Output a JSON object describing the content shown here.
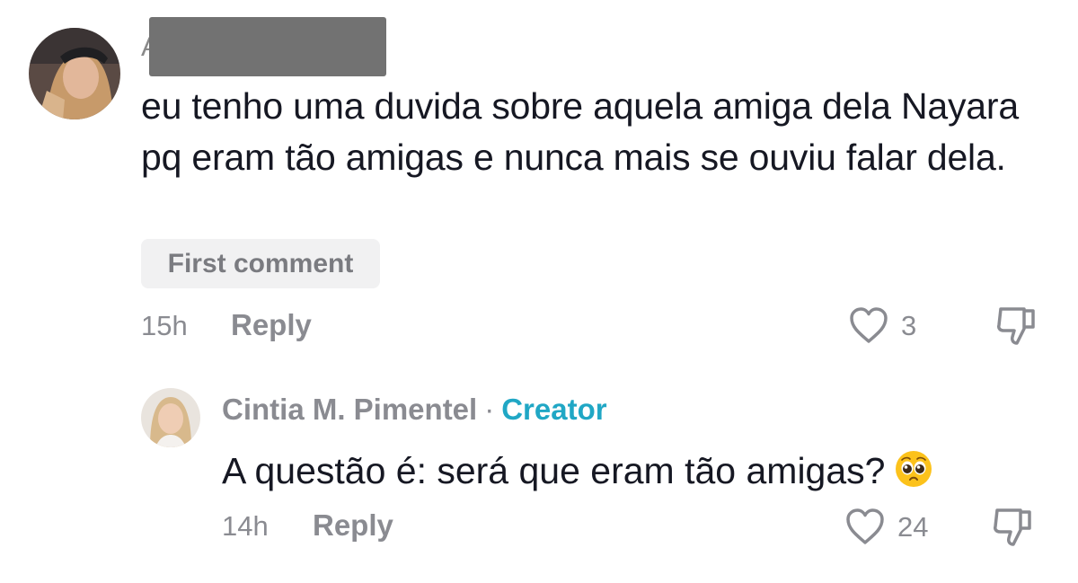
{
  "comment": {
    "text": "eu tenho uma duvida sobre aquela amiga dela Nayara pq eram tão amigas e nunca mais se ouviu falar dela.",
    "badge": "First comment",
    "time": "15h",
    "reply_label": "Reply",
    "likes": "3",
    "avatar_icon": "user-avatar-photo"
  },
  "reply": {
    "author": "Cintia M. Pimentel",
    "separator": "·",
    "role": "Creator",
    "text": "A questão é: será que eram tão amigas?",
    "emoji_icon": "pleading-face-emoji",
    "time": "14h",
    "reply_label": "Reply",
    "likes": "24",
    "avatar_icon": "creator-avatar-photo"
  },
  "colors": {
    "text": "#161823",
    "muted": "#8a8b91",
    "creator": "#20a7c5",
    "badge_bg": "#f1f1f2"
  },
  "icons": [
    "heart-outline-icon",
    "thumbs-down-icon"
  ]
}
